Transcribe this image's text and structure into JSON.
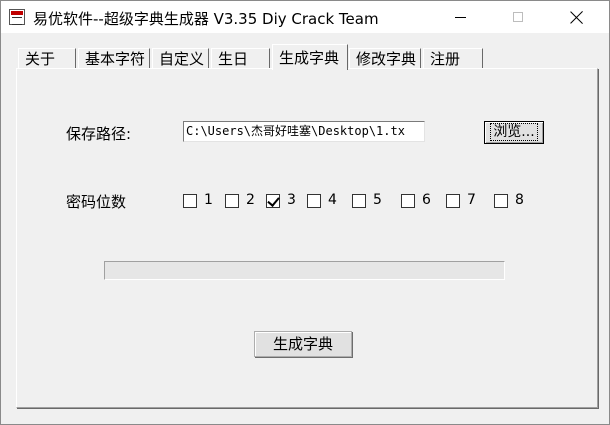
{
  "window": {
    "title": "易优软件--超级字典生成器 V3.35  Diy Crack Team"
  },
  "tabs": [
    {
      "label": "关于",
      "active": false
    },
    {
      "label": "基本字符",
      "active": false
    },
    {
      "label": "自定义",
      "active": false
    },
    {
      "label": "生日",
      "active": false
    },
    {
      "label": "生成字典",
      "active": true
    },
    {
      "label": "修改字典",
      "active": false
    },
    {
      "label": "注册",
      "active": false
    }
  ],
  "save_path": {
    "label": "保存路径:",
    "value": "C:\\Users\\杰哥好哇塞\\Desktop\\1.tx",
    "browse_label": "浏览..."
  },
  "password_digits": {
    "label": "密码位数",
    "options": [
      {
        "label": "1",
        "checked": false
      },
      {
        "label": "2",
        "checked": false
      },
      {
        "label": "3",
        "checked": true
      },
      {
        "label": "4",
        "checked": false
      },
      {
        "label": "5",
        "checked": false
      },
      {
        "label": "6",
        "checked": false
      },
      {
        "label": "7",
        "checked": false
      },
      {
        "label": "8",
        "checked": false
      }
    ]
  },
  "progress": {
    "value": 0
  },
  "generate_button": "生成字典"
}
